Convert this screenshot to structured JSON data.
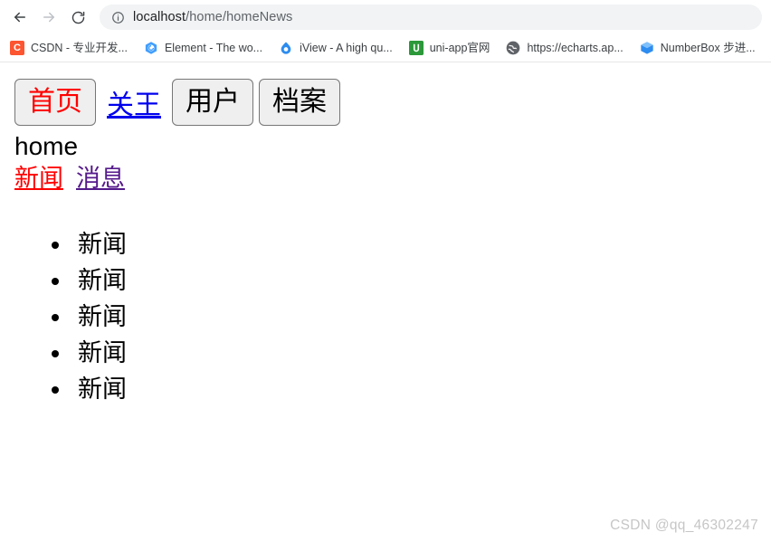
{
  "browser": {
    "toolbar": {
      "back_icon": "arrow-left-icon",
      "forward_icon": "arrow-right-icon",
      "reload_icon": "reload-icon",
      "site_info_icon": "info-circle-icon",
      "url_host": "localhost",
      "url_path": "/home/homeNews",
      "url_full": "localhost/home/homeNews"
    },
    "bookmarks": [
      {
        "label": "CSDN - 专业开发...",
        "icon": "csdn-favicon",
        "glyph": "C"
      },
      {
        "label": "Element - The wo...",
        "icon": "element-favicon",
        "glyph": ""
      },
      {
        "label": "iView - A high qu...",
        "icon": "iview-favicon",
        "glyph": ""
      },
      {
        "label": "uni-app官网",
        "icon": "uniapp-favicon",
        "glyph": "U"
      },
      {
        "label": "https://echarts.ap...",
        "icon": "globe-favicon",
        "glyph": ""
      },
      {
        "label": "NumberBox 步进...",
        "icon": "numberbox-favicon",
        "glyph": ""
      }
    ]
  },
  "page": {
    "nav": [
      {
        "label": "首页",
        "type": "button",
        "state": "active",
        "color": "#ff0000"
      },
      {
        "label": "关王",
        "type": "link",
        "color": "#0000ee"
      },
      {
        "label": "用户",
        "type": "button",
        "color": "#000000"
      },
      {
        "label": "档案",
        "type": "button",
        "color": "#000000"
      }
    ],
    "title": "home",
    "sub_links": [
      {
        "label": "新闻",
        "state": "active",
        "color": "#ff0000"
      },
      {
        "label": "消息",
        "state": "visited",
        "color": "#551a8b"
      }
    ],
    "news_items": [
      "新闻",
      "新闻",
      "新闻",
      "新闻",
      "新闻"
    ],
    "watermark": "CSDN @qq_46302247"
  }
}
